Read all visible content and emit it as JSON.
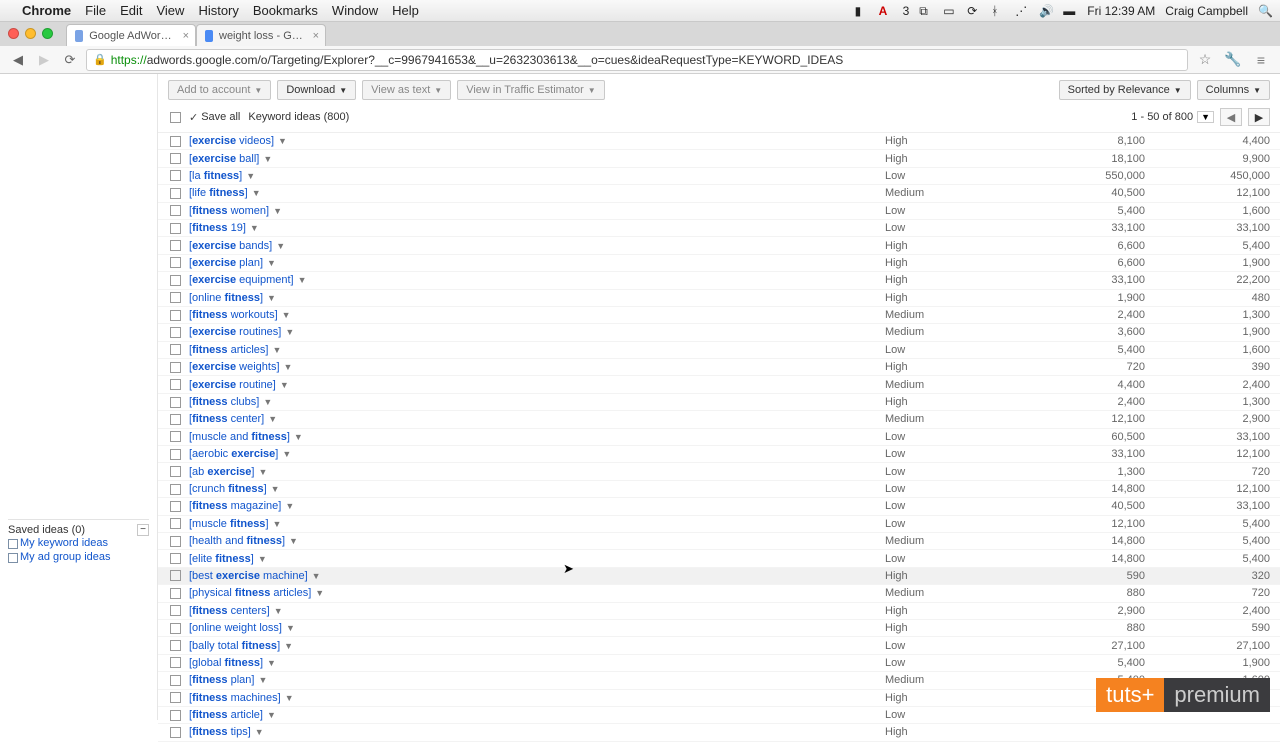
{
  "mac": {
    "app": "Chrome",
    "menus": [
      "File",
      "Edit",
      "View",
      "History",
      "Bookmarks",
      "Window",
      "Help"
    ],
    "clock": "Fri 12:39 AM",
    "user": "Craig Campbell"
  },
  "chrome": {
    "tabs": [
      {
        "label": "Google AdWords: Keywo"
      },
      {
        "label": "weight loss - Google Sear"
      }
    ],
    "url_prefix": "https://",
    "url": "adwords.google.com/o/Targeting/Explorer?__c=9967941653&__u=2632303613&__o=cues&ideaRequestType=KEYWORD_IDEAS"
  },
  "toolbar": {
    "add": "Add to account",
    "download": "Download",
    "viewtext": "View as text",
    "traffic": "View in Traffic Estimator",
    "sorted": "Sorted by Relevance",
    "columns": "Columns"
  },
  "header": {
    "saveall": "Save all",
    "title": "Keyword ideas (800)",
    "range": "1 - 50 of 800"
  },
  "sidebar": {
    "title": "Saved ideas (0)",
    "items": [
      "My keyword ideas",
      "My ad group ideas"
    ]
  },
  "watermark": {
    "a": "tuts+",
    "b": "premium"
  },
  "cursor_row_index": 25,
  "rows": [
    {
      "pre": "",
      "bold": "exercise",
      "post": " videos",
      "comp": "High",
      "v1": "8,100",
      "v2": "4,400"
    },
    {
      "pre": "",
      "bold": "exercise",
      "post": " ball",
      "comp": "High",
      "v1": "18,100",
      "v2": "9,900"
    },
    {
      "pre": "la ",
      "bold": "fitness",
      "post": "",
      "comp": "Low",
      "v1": "550,000",
      "v2": "450,000"
    },
    {
      "pre": "life ",
      "bold": "fitness",
      "post": "",
      "comp": "Medium",
      "v1": "40,500",
      "v2": "12,100"
    },
    {
      "pre": "",
      "bold": "fitness",
      "post": " women",
      "comp": "Low",
      "v1": "5,400",
      "v2": "1,600"
    },
    {
      "pre": "",
      "bold": "fitness",
      "post": " 19",
      "comp": "Low",
      "v1": "33,100",
      "v2": "33,100"
    },
    {
      "pre": "",
      "bold": "exercise",
      "post": " bands",
      "comp": "High",
      "v1": "6,600",
      "v2": "5,400"
    },
    {
      "pre": "",
      "bold": "exercise",
      "post": " plan",
      "comp": "High",
      "v1": "6,600",
      "v2": "1,900"
    },
    {
      "pre": "",
      "bold": "exercise",
      "post": " equipment",
      "comp": "High",
      "v1": "33,100",
      "v2": "22,200"
    },
    {
      "pre": "online ",
      "bold": "fitness",
      "post": "",
      "comp": "High",
      "v1": "1,900",
      "v2": "480"
    },
    {
      "pre": "",
      "bold": "fitness",
      "post": " workouts",
      "comp": "Medium",
      "v1": "2,400",
      "v2": "1,300"
    },
    {
      "pre": "",
      "bold": "exercise",
      "post": " routines",
      "comp": "Medium",
      "v1": "3,600",
      "v2": "1,900"
    },
    {
      "pre": "",
      "bold": "fitness",
      "post": " articles",
      "comp": "Low",
      "v1": "5,400",
      "v2": "1,600"
    },
    {
      "pre": "",
      "bold": "exercise",
      "post": " weights",
      "comp": "High",
      "v1": "720",
      "v2": "390"
    },
    {
      "pre": "",
      "bold": "exercise",
      "post": " routine",
      "comp": "Medium",
      "v1": "4,400",
      "v2": "2,400"
    },
    {
      "pre": "",
      "bold": "fitness",
      "post": " clubs",
      "comp": "High",
      "v1": "2,400",
      "v2": "1,300"
    },
    {
      "pre": "",
      "bold": "fitness",
      "post": " center",
      "comp": "Medium",
      "v1": "12,100",
      "v2": "2,900"
    },
    {
      "pre": "muscle and ",
      "bold": "fitness",
      "post": "",
      "comp": "Low",
      "v1": "60,500",
      "v2": "33,100"
    },
    {
      "pre": "aerobic ",
      "bold": "exercise",
      "post": "",
      "comp": "Low",
      "v1": "33,100",
      "v2": "12,100"
    },
    {
      "pre": "ab ",
      "bold": "exercise",
      "post": "",
      "comp": "Low",
      "v1": "1,300",
      "v2": "720"
    },
    {
      "pre": "crunch ",
      "bold": "fitness",
      "post": "",
      "comp": "Low",
      "v1": "14,800",
      "v2": "12,100"
    },
    {
      "pre": "",
      "bold": "fitness",
      "post": " magazine",
      "comp": "Low",
      "v1": "40,500",
      "v2": "33,100"
    },
    {
      "pre": "muscle ",
      "bold": "fitness",
      "post": "",
      "comp": "Low",
      "v1": "12,100",
      "v2": "5,400"
    },
    {
      "pre": "health and ",
      "bold": "fitness",
      "post": "",
      "comp": "Medium",
      "v1": "14,800",
      "v2": "5,400"
    },
    {
      "pre": "elite ",
      "bold": "fitness",
      "post": "",
      "comp": "Low",
      "v1": "14,800",
      "v2": "5,400"
    },
    {
      "pre": "best ",
      "bold": "exercise",
      "post": " machine",
      "comp": "High",
      "v1": "590",
      "v2": "320"
    },
    {
      "pre": "physical ",
      "bold": "fitness",
      "post": " articles",
      "comp": "Medium",
      "v1": "880",
      "v2": "720"
    },
    {
      "pre": "",
      "bold": "fitness",
      "post": " centers",
      "comp": "High",
      "v1": "2,900",
      "v2": "2,400"
    },
    {
      "pre": "online weight loss",
      "bold": "",
      "post": "",
      "comp": "High",
      "v1": "880",
      "v2": "590"
    },
    {
      "pre": "bally total ",
      "bold": "fitness",
      "post": "",
      "comp": "Low",
      "v1": "27,100",
      "v2": "27,100"
    },
    {
      "pre": "global ",
      "bold": "fitness",
      "post": "",
      "comp": "Low",
      "v1": "5,400",
      "v2": "1,900"
    },
    {
      "pre": "",
      "bold": "fitness",
      "post": " plan",
      "comp": "Medium",
      "v1": "5,400",
      "v2": "1,600"
    },
    {
      "pre": "",
      "bold": "fitness",
      "post": " machines",
      "comp": "High",
      "v1": "",
      "v2": ""
    },
    {
      "pre": "",
      "bold": "fitness",
      "post": " article",
      "comp": "Low",
      "v1": "",
      "v2": ""
    },
    {
      "pre": "",
      "bold": "fitness",
      "post": " tips",
      "comp": "High",
      "v1": "",
      "v2": ""
    }
  ]
}
